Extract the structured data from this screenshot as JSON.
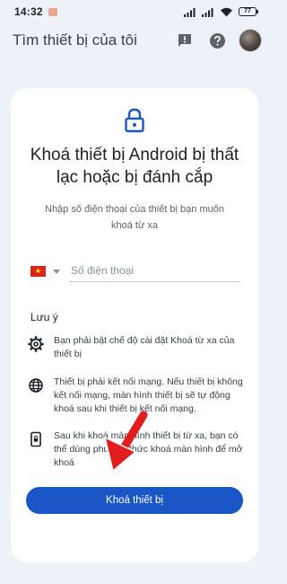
{
  "status_bar": {
    "time": "14:32",
    "battery": "77",
    "icons": [
      "notification-dot",
      "signal-icon",
      "signal-icon",
      "wifi-icon",
      "battery-icon"
    ]
  },
  "app_bar": {
    "title": "Tìm thiết bị của tôi",
    "icons": [
      "feedback-icon",
      "help-icon",
      "avatar"
    ]
  },
  "card": {
    "icon": "lock-icon",
    "title": "Khoá thiết bị Android bị thất lạc hoặc bị đánh cắp",
    "subtitle": "Nhập số điện thoại của thiết bị bạn muốn khoá từ xa",
    "phone": {
      "country": "Vietnam flag",
      "placeholder": "Số điện thoại",
      "value": ""
    },
    "notes_title": "Lưu ý",
    "notes": [
      {
        "icon": "settings-icon",
        "text": "Bạn phải bật chế độ cài đặt Khoá từ xa của thiết bị"
      },
      {
        "icon": "globe-icon",
        "text": "Thiết bị phải kết nối mạng. Nếu thiết bị không kết nối mạng, màn hình thiết bị sẽ tự động khoá sau khi thiết bị kết nối mạng."
      },
      {
        "icon": "lock-screen-phone-icon",
        "text": "Sau khi khoá màn hình thiết bị từ xa, bạn có thể dùng phương thức khoá màn hình để mở khoá"
      }
    ],
    "button_label": "Khoá thiết bị"
  },
  "colors": {
    "background": "#eef1f8",
    "card": "#ffffff",
    "accent": "#1a56c5",
    "annotation_arrow": "#e11d1d"
  }
}
